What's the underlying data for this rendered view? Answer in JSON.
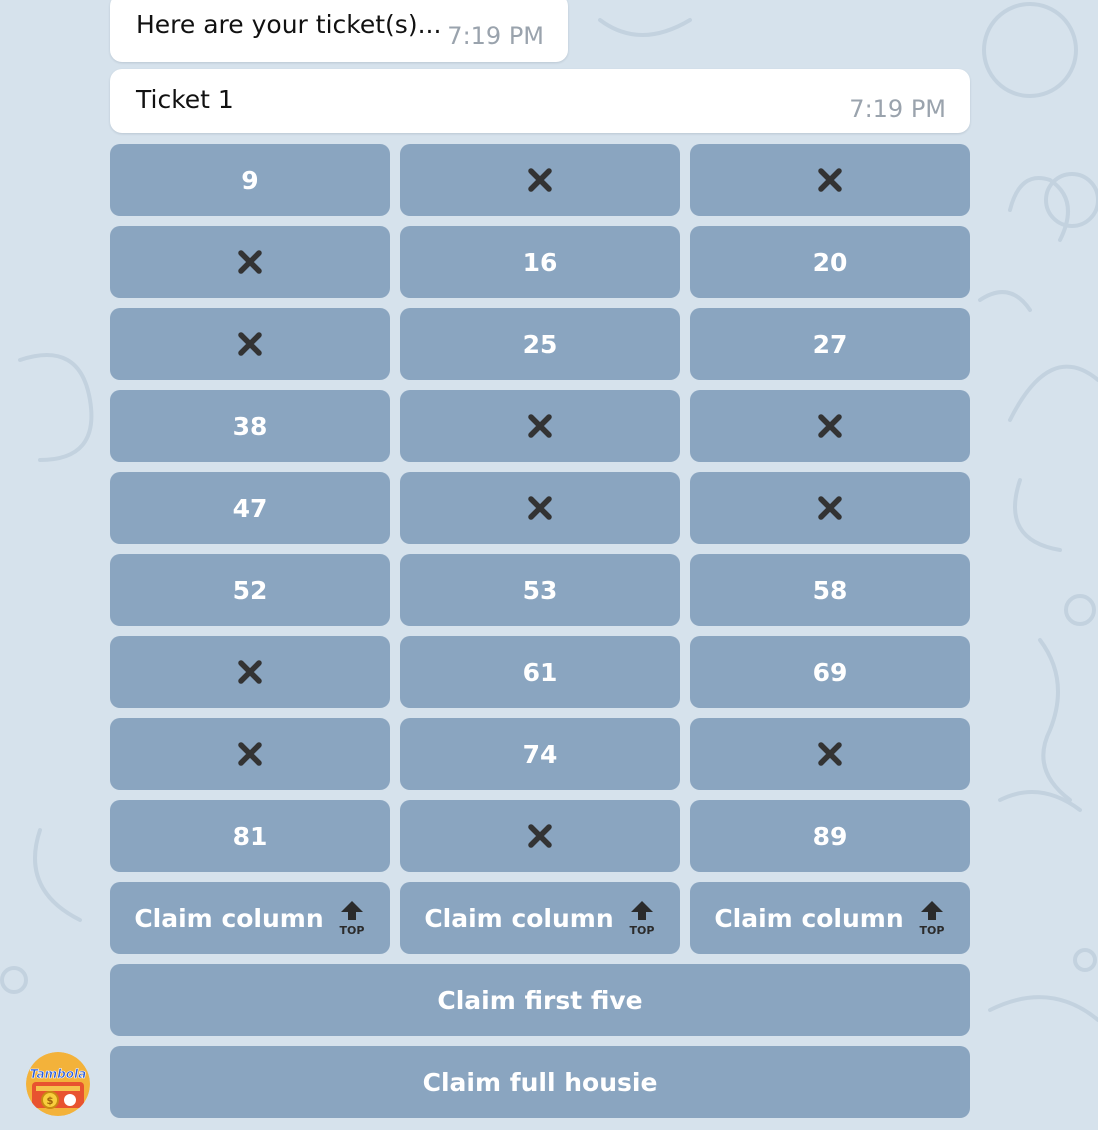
{
  "messages": [
    {
      "text": "Here are your ticket(s)...",
      "time": "7:19 PM"
    },
    {
      "text": "Ticket 1",
      "time": "7:19 PM"
    }
  ],
  "ticket_grid": [
    [
      {
        "label": "9"
      },
      {
        "label": "",
        "icon": "cross-mark-icon"
      },
      {
        "label": "",
        "icon": "cross-mark-icon"
      }
    ],
    [
      {
        "label": "",
        "icon": "cross-mark-icon"
      },
      {
        "label": "16"
      },
      {
        "label": "20"
      }
    ],
    [
      {
        "label": "",
        "icon": "cross-mark-icon"
      },
      {
        "label": "25"
      },
      {
        "label": "27"
      }
    ],
    [
      {
        "label": "38"
      },
      {
        "label": "",
        "icon": "cross-mark-icon"
      },
      {
        "label": "",
        "icon": "cross-mark-icon"
      }
    ],
    [
      {
        "label": "47"
      },
      {
        "label": "",
        "icon": "cross-mark-icon"
      },
      {
        "label": "",
        "icon": "cross-mark-icon"
      }
    ],
    [
      {
        "label": "52"
      },
      {
        "label": "53"
      },
      {
        "label": "58"
      }
    ],
    [
      {
        "label": "",
        "icon": "cross-mark-icon"
      },
      {
        "label": "61"
      },
      {
        "label": "69"
      }
    ],
    [
      {
        "label": "",
        "icon": "cross-mark-icon"
      },
      {
        "label": "74"
      },
      {
        "label": "",
        "icon": "cross-mark-icon"
      }
    ],
    [
      {
        "label": "81"
      },
      {
        "label": "",
        "icon": "cross-mark-icon"
      },
      {
        "label": "89"
      }
    ]
  ],
  "claim_column_buttons": [
    {
      "label": "Claim column",
      "icon": "top-arrow-icon",
      "icon_text": "TOP"
    },
    {
      "label": "Claim column",
      "icon": "top-arrow-icon",
      "icon_text": "TOP"
    },
    {
      "label": "Claim column",
      "icon": "top-arrow-icon",
      "icon_text": "TOP"
    }
  ],
  "claim_first_five": {
    "label": "Claim first five"
  },
  "claim_full_housie": {
    "label": "Claim full housie"
  },
  "bot_avatar": {
    "icon": "tambola-logo-icon",
    "logo_text": "Tambola"
  },
  "colors": {
    "background": "#d6e2ec",
    "button_bg": "#7494b3",
    "bubble_bg": "#ffffff",
    "timestamp": "#9aa3ad",
    "cross_mark": "#333333"
  }
}
